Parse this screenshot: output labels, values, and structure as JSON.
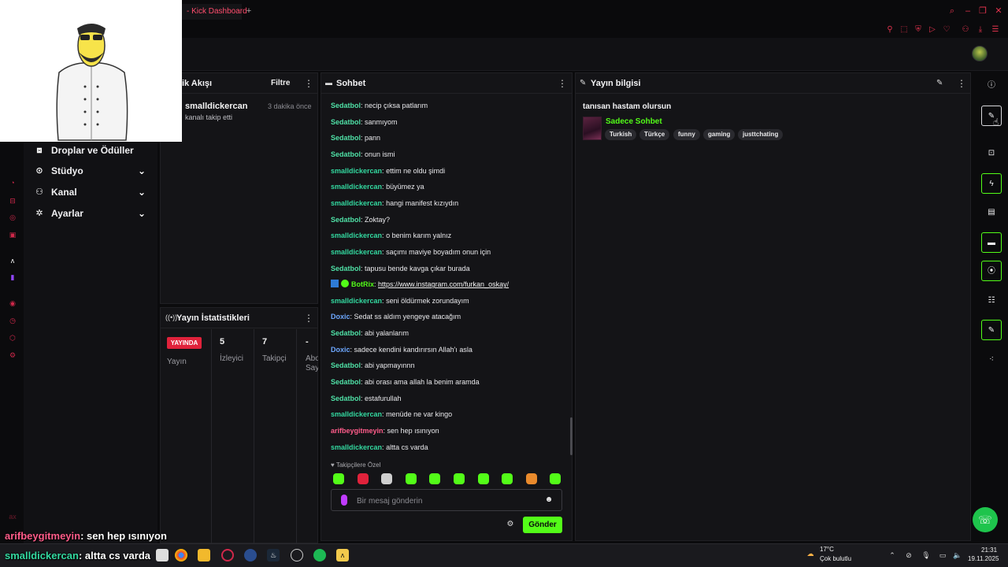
{
  "browser": {
    "tab_title": "- Kick Dashboard",
    "new_tab": "+"
  },
  "sidebar": {
    "items": [
      {
        "label": "Droplar ve Ödüller",
        "icon": "gift-icon"
      },
      {
        "label": "Stüdyo",
        "icon": "studio-icon"
      },
      {
        "label": "Kanal",
        "icon": "people-icon"
      },
      {
        "label": "Ayarlar",
        "icon": "gear-icon"
      }
    ]
  },
  "event_feed": {
    "title": "kinlik Akışı",
    "filter": "Filtre",
    "event": {
      "user": "smalldickercan",
      "text": "kanalı takip etti",
      "time": "3 dakika önce"
    }
  },
  "stats": {
    "title": "Yayın İstatistikleri",
    "live_badge": "YAYINDA",
    "columns": [
      {
        "label": "Yayın",
        "value": ""
      },
      {
        "label": "İzleyici",
        "value": "5"
      },
      {
        "label": "Takipçi",
        "value": "7"
      },
      {
        "label": "Abo Say",
        "value": "-"
      }
    ]
  },
  "chat": {
    "title": "Sohbet",
    "messages": [
      {
        "user": "Sedatbol",
        "color": "#4fe0a6",
        "text": "necip çıksa patlarım"
      },
      {
        "user": "Sedatbol",
        "color": "#4fe0a6",
        "text": "sanmıyom"
      },
      {
        "user": "Sedatbol",
        "color": "#4fe0a6",
        "text": "pann"
      },
      {
        "user": "Sedatbol",
        "color": "#4fe0a6",
        "text": "onun ismi"
      },
      {
        "user": "smalldickercan",
        "color": "#33d9a0",
        "text": "ettim ne oldu şimdi"
      },
      {
        "user": "smalldickercan",
        "color": "#33d9a0",
        "text": "büyümez ya"
      },
      {
        "user": "smalldickercan",
        "color": "#33d9a0",
        "text": "hangi manifest kızıydın"
      },
      {
        "user": "Sedatbol",
        "color": "#4fe0a6",
        "text": "Zoktay?"
      },
      {
        "user": "smalldickercan",
        "color": "#33d9a0",
        "text": "o benim karım yalnız"
      },
      {
        "user": "smalldickercan",
        "color": "#33d9a0",
        "text": "saçımı maviye boyadım onun için"
      },
      {
        "user": "Sedatbol",
        "color": "#4fe0a6",
        "text": "tapusu bende kavga çıkar burada"
      },
      {
        "user": "BotRix",
        "color": "#53fc18",
        "text": "https://www.instagram.com/furkan_oskay/",
        "is_link": true
      },
      {
        "user": "smalldickercan",
        "color": "#33d9a0",
        "text": "seni öldürmek zorundayım"
      },
      {
        "user": "Doxic",
        "color": "#6ea8ff",
        "text": "Sedat ss aldım yengeye atacağım"
      },
      {
        "user": "Sedatbol",
        "color": "#4fe0a6",
        "text": "abi yalanlarım"
      },
      {
        "user": "Doxic",
        "color": "#6ea8ff",
        "text": "sadece kendini kandırırsın Allah'ı asla"
      },
      {
        "user": "Sedatbol",
        "color": "#4fe0a6",
        "text": "abi yapmayınnn"
      },
      {
        "user": "Sedatbol",
        "color": "#4fe0a6",
        "text": "abi orası ama allah la benim aramda"
      },
      {
        "user": "Sedatbol",
        "color": "#4fe0a6",
        "text": "estafurullah"
      },
      {
        "user": "smalldickercan",
        "color": "#33d9a0",
        "text": "menüde ne var kingo"
      },
      {
        "user": "arifbeygitmeyin",
        "color": "#ff5c8a",
        "text": "sen hep ısınıyon"
      },
      {
        "user": "smalldickercan",
        "color": "#33d9a0",
        "text": "altta cs varda"
      }
    ],
    "followers_only_label": "♥ Takipçilere Özel",
    "input_placeholder": "Bir mesaj gönderin",
    "send_label": "Gönder"
  },
  "stream_info": {
    "title": "Yayın bilgisi",
    "stream_title": "tanısan hastam olursun",
    "category": "Sadece Sohbet",
    "tags": [
      "Turkish",
      "Türkçe",
      "funny",
      "gaming",
      "justtchating"
    ]
  },
  "overlay_captions": [
    {
      "user": "arifbeygitmeyin",
      "user_color": "#ff5c8a",
      "text": ": sen hep ısınıyon"
    },
    {
      "user": "smalldickercan",
      "user_color": "#33d9a0",
      "text": ": altta cs varda"
    }
  ],
  "taskbar": {
    "weather_temp": "17°C",
    "weather_desc": "Çok bulutlu",
    "time": "21:31",
    "date": "19.11.2025"
  },
  "colors": {
    "kick_green": "#53fc18",
    "live_red": "#e0223b",
    "panel_bg": "#141417"
  }
}
